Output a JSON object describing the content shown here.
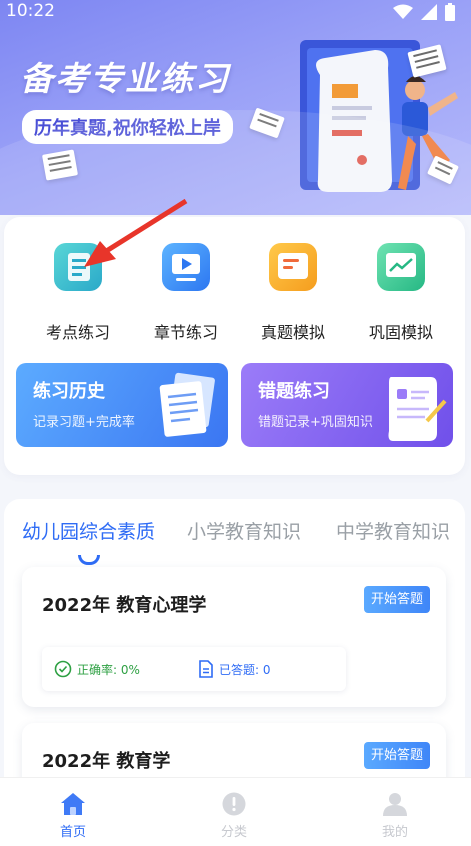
{
  "status_bar": {
    "time": "10:22"
  },
  "banner": {
    "title": "备考专业练习",
    "subtitle": "历年真题,祝你轻松上岸"
  },
  "quick_actions": [
    {
      "label": "考点练习",
      "icon": "notebook-icon"
    },
    {
      "label": "章节练习",
      "icon": "video-play-icon"
    },
    {
      "label": "真题模拟",
      "icon": "folder-icon"
    },
    {
      "label": "巩固模拟",
      "icon": "chart-screen-icon"
    }
  ],
  "promos": {
    "history": {
      "title": "练习历史",
      "subtitle": "记录习题+完成率"
    },
    "mistakes": {
      "title": "错题练习",
      "subtitle": "错题记录+巩固知识"
    }
  },
  "tabs": [
    {
      "label": "幼儿园综合素质",
      "active": true
    },
    {
      "label": "小学教育知识",
      "active": false
    },
    {
      "label": "中学教育知识",
      "active": false
    }
  ],
  "exams": [
    {
      "title": "2022年 教育心理学",
      "button": "开始答题",
      "accuracy": "正确率: 0%",
      "answered": "已答题: 0"
    },
    {
      "title": "2022年 教育学",
      "button": "开始答题"
    }
  ],
  "bottom_nav": [
    {
      "label": "首页",
      "active": true
    },
    {
      "label": "分类",
      "active": false
    },
    {
      "label": "我的",
      "active": false
    }
  ],
  "colors": {
    "accent": "#2f6cf5",
    "banner": "#8a92f4",
    "success": "#2ea043"
  }
}
